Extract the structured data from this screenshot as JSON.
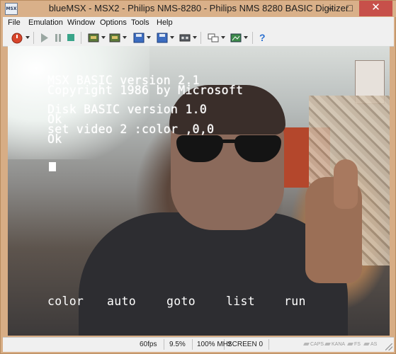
{
  "window": {
    "title": "blueMSX - MSX2 - Philips NMS-8280 - Philips NMS 8280 BASIC Digitizer",
    "app_icon_label": "MSX",
    "min_glyph": "–",
    "max_glyph": "□",
    "close_glyph": "✕"
  },
  "menu": [
    "File",
    "Emulation",
    "Window",
    "Options",
    "Tools",
    "Help"
  ],
  "toolbar": {
    "icons": [
      "power-icon",
      "play-icon",
      "pause-icon",
      "stop-icon",
      "cartridge-slot-1-icon",
      "cartridge-slot-2-icon",
      "disk-drive-a-icon",
      "disk-drive-b-icon",
      "cassette-icon",
      "window-size-icon",
      "video-capture-icon",
      "help-icon"
    ],
    "help_glyph": "?"
  },
  "screen": {
    "lines": [
      "MSX BASIC version 2.1",
      "Copyright 1986 by Microsoft",
      "",
      "Disk BASIC version 1.0",
      "Ok",
      "set video 2 :color ,0,0",
      "Ok"
    ],
    "function_keys": [
      "color",
      "auto",
      "goto",
      "list",
      "run"
    ]
  },
  "status": {
    "fps": "60fps",
    "cpu": "9.5%",
    "speed": "100% MHz",
    "mode": "SCREEN 0",
    "leds": [
      "CAPS",
      "KANA",
      "FS",
      "AS"
    ]
  }
}
